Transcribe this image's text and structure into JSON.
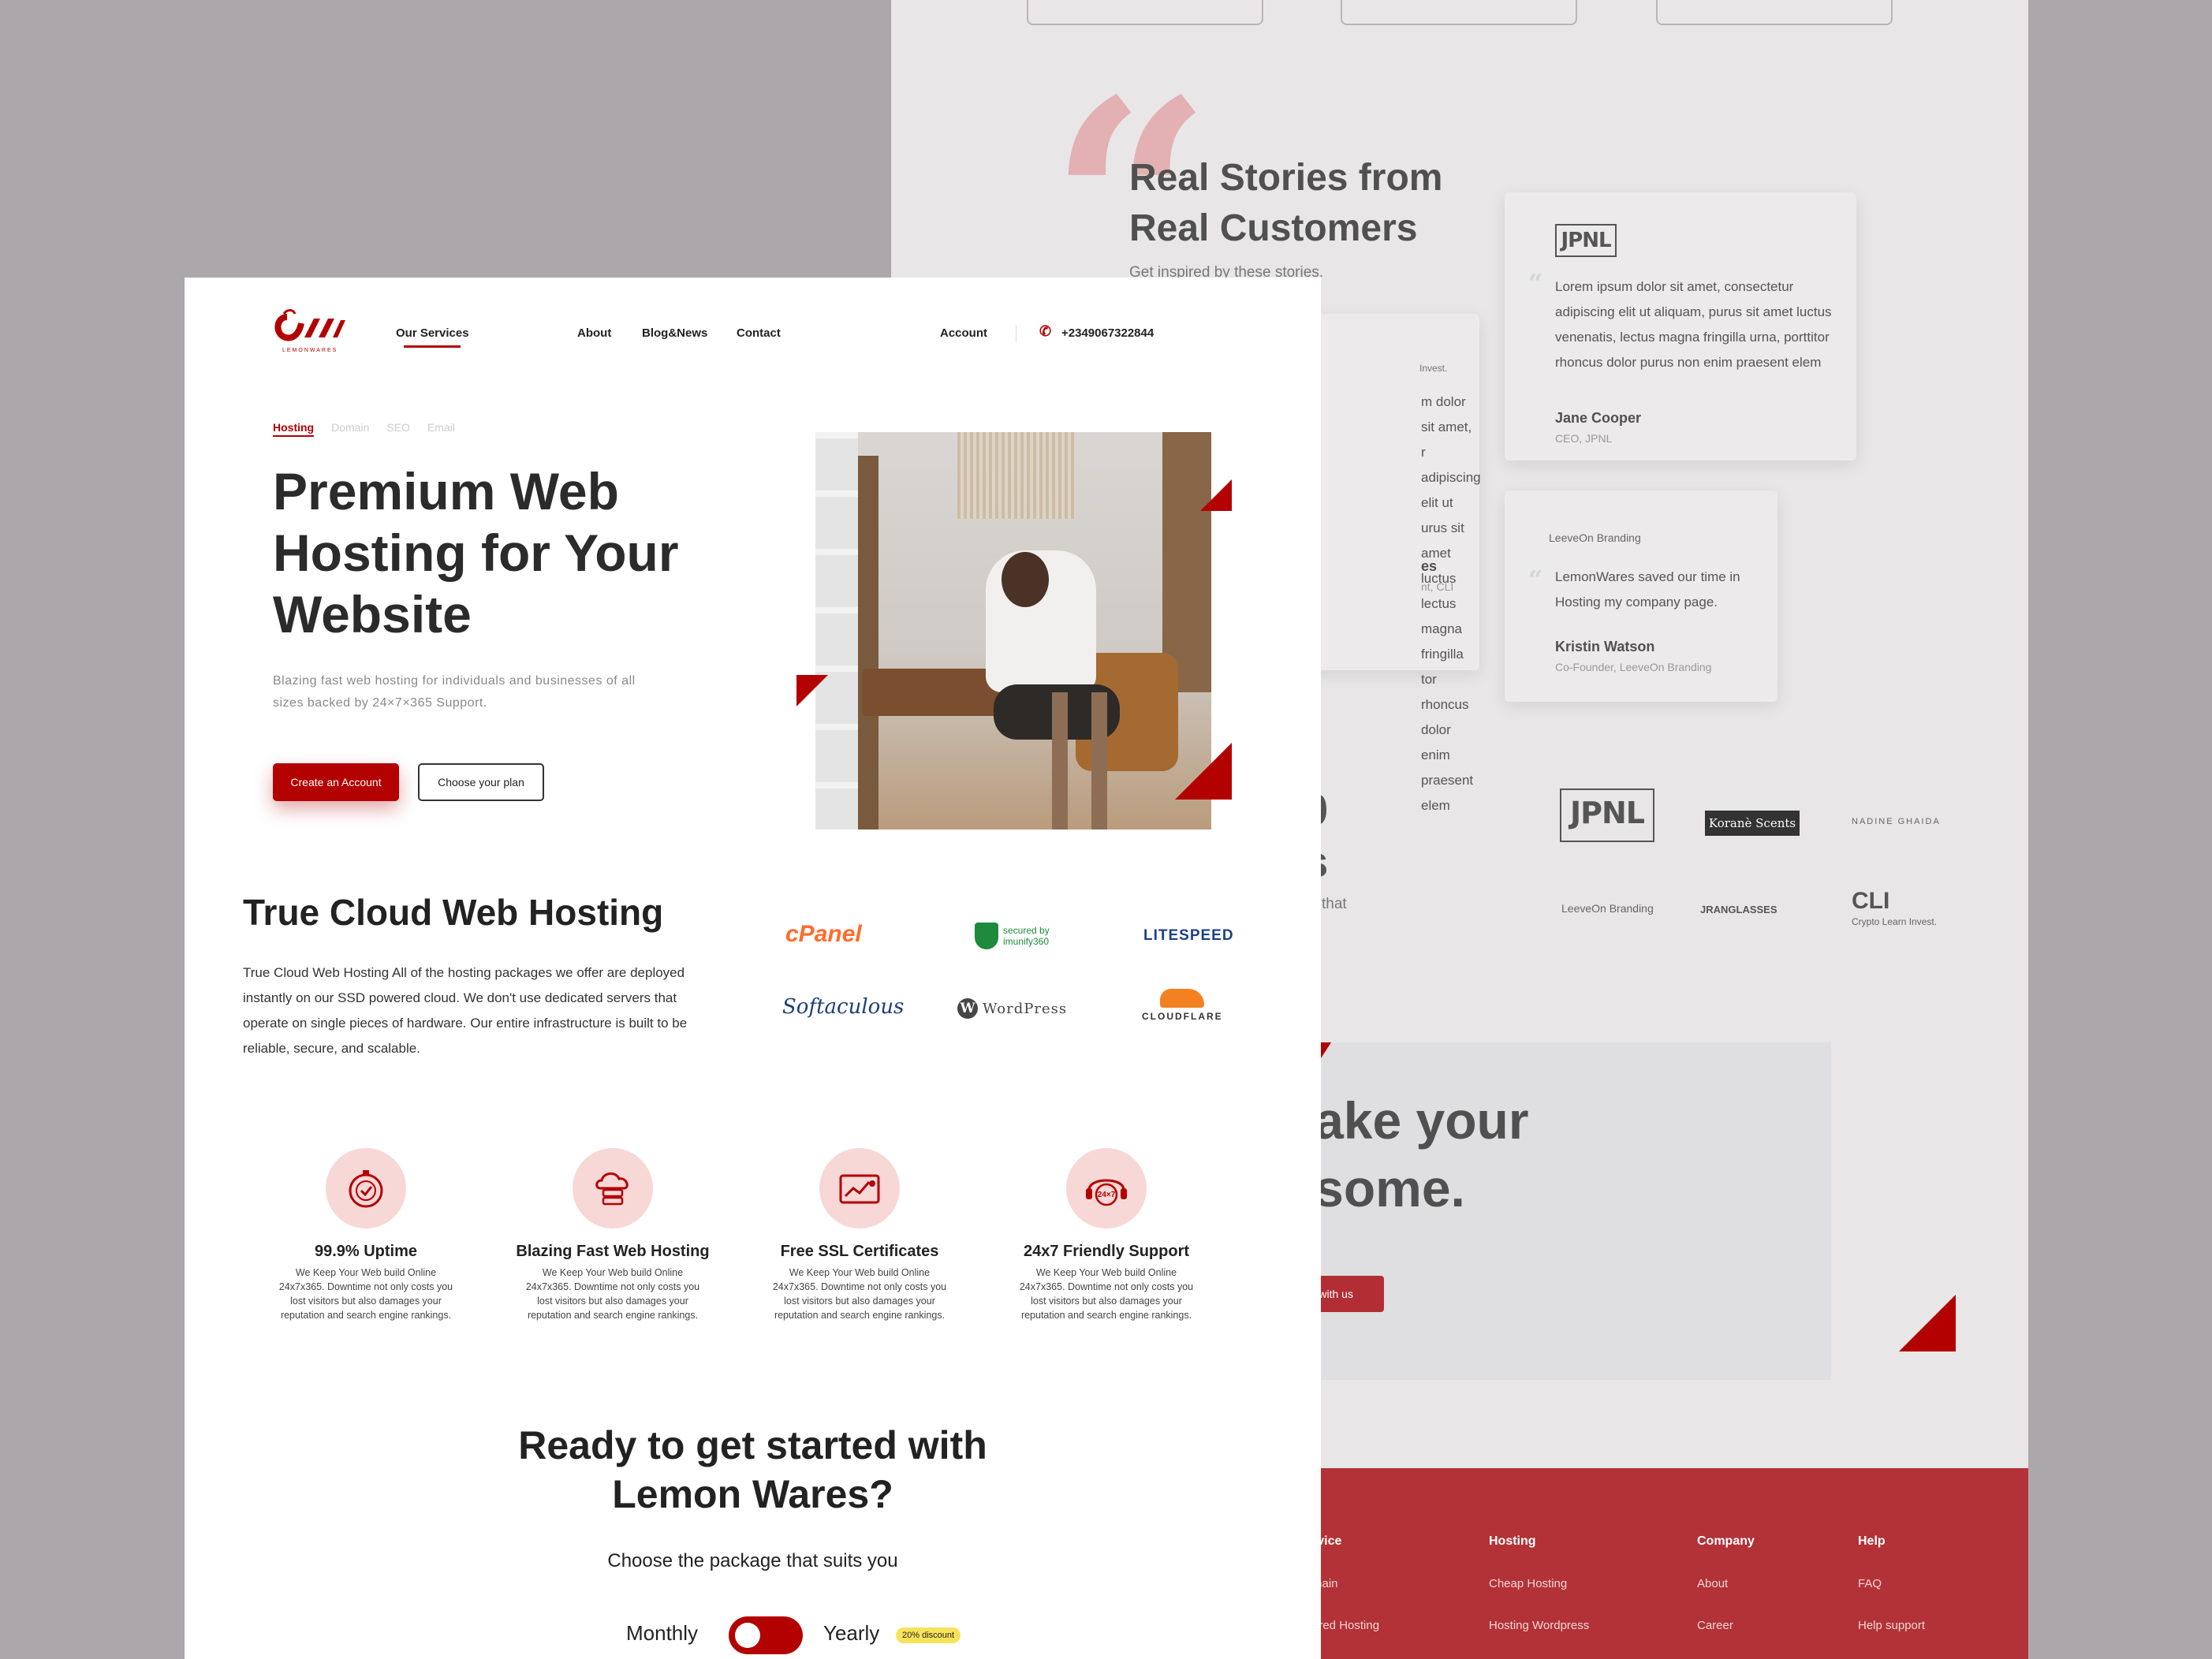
{
  "back": {
    "testimonials": {
      "title_line1": "Real Stories from",
      "title_line2": "Real Customers",
      "subtitle": "Get inspired by these stories.",
      "partial_card": {
        "role_fragment": "Invest.",
        "lines": [
          "m dolor sit amet,",
          "r adipiscing elit ut",
          "urus sit amet luctus",
          "lectus magna fringilla",
          "tor rhoncus dolor",
          "enim praesent elem"
        ],
        "name_fragment": "es",
        "role2_fragment": "nt, CLI"
      },
      "card1": {
        "logo": "JPNL",
        "text": "Lorem ipsum dolor sit amet, consectetur adipiscing elit ut aliquam, purus sit amet luctus venenatis, lectus magna fringilla urna, porttitor rhoncus dolor purus non enim praesent elem",
        "name": "Jane Cooper",
        "role": "CEO, JPNL"
      },
      "card2": {
        "logo": "LeeveOn Branding",
        "text": "LemonWares saved our time in Hosting my company page.",
        "name": "Kristin Watson",
        "role": "Co-Founder, LeeveOn Branding"
      }
    },
    "stats_fragment": {
      "num": "00",
      "label": "es",
      "text": "that"
    },
    "client_logos": [
      "JPNL",
      "Koranè Scents",
      "NADINE GHAIDA",
      "LeeveOn Branding",
      "JRANGLASSES",
      "CLI",
      "Crypto Learn Invest."
    ],
    "cta": {
      "line1": "here to make your",
      "line2": "osite awesome.",
      "button": "Get in touch with us"
    },
    "footer": {
      "columns": [
        {
          "heading": "rvice",
          "links": [
            "main",
            "ared Hosting"
          ]
        },
        {
          "heading": "Hosting",
          "links": [
            "Cheap Hosting",
            "Hosting Wordpress"
          ]
        },
        {
          "heading": "Company",
          "links": [
            "About",
            "Career"
          ]
        },
        {
          "heading": "Help",
          "links": [
            "FAQ",
            "Help support"
          ]
        }
      ]
    },
    "brand_red": "#b30000"
  },
  "front": {
    "logo_text": "LEMONWARES",
    "nav": {
      "services": "Our Services",
      "about": "About",
      "blog": "Blog&News",
      "contact": "Contact",
      "account": "Account",
      "phone": "+2349067322844"
    },
    "tabs": [
      "Hosting",
      "Domain",
      "SEO",
      "Email"
    ],
    "hero": {
      "title": "Premium Web Hosting for Your Website",
      "subtitle": "Blazing fast web hosting for individuals and businesses of all sizes backed by 24×7×365 Support.",
      "primary_btn": "Create an Account",
      "secondary_btn": "Choose your plan"
    },
    "cloud": {
      "title": "True Cloud Web  Hosting",
      "text": "True Cloud Web Hosting All of the hosting packages we offer are deployed instantly on our SSD powered cloud. We don't use dedicated servers that operate on single pieces of hardware. Our entire infrastructure is built to be reliable, secure, and scalable.",
      "partners": [
        "cPanel",
        "secured by imunify360",
        "LITESPEED",
        "Softaculous",
        "WordPress",
        "CLOUDFLARE"
      ]
    },
    "features": [
      {
        "title": "99.9% Uptime",
        "text": "We Keep Your Web build Online 24x7x365. Downtime not only costs you lost visitors but also damages your reputation and search engine rankings.",
        "icon": "stopwatch-icon"
      },
      {
        "title": "Blazing Fast Web Hosting",
        "text": "We Keep Your Web build Online 24x7x365. Downtime not only costs you lost visitors but also damages your reputation and search engine rankings.",
        "icon": "cloud-server-icon"
      },
      {
        "title": "Free SSL Certificates",
        "text": "We Keep Your Web build Online 24x7x365. Downtime not only costs you lost visitors but also damages your reputation and search engine rankings.",
        "icon": "chart-certificate-icon"
      },
      {
        "title": "24x7 Friendly Support",
        "text": "We Keep Your Web build Online 24x7x365. Downtime not only costs you lost visitors but also damages your reputation and search engine rankings.",
        "icon": "headset-24x7-icon",
        "icon_text": "24×7"
      }
    ],
    "pricing": {
      "title_line1": "Ready to get started with",
      "title_line2": "Lemon Wares?",
      "subtitle": "Choose the package that suits you",
      "monthly": "Monthly",
      "yearly": "Yearly",
      "discount": "20% discount"
    }
  }
}
